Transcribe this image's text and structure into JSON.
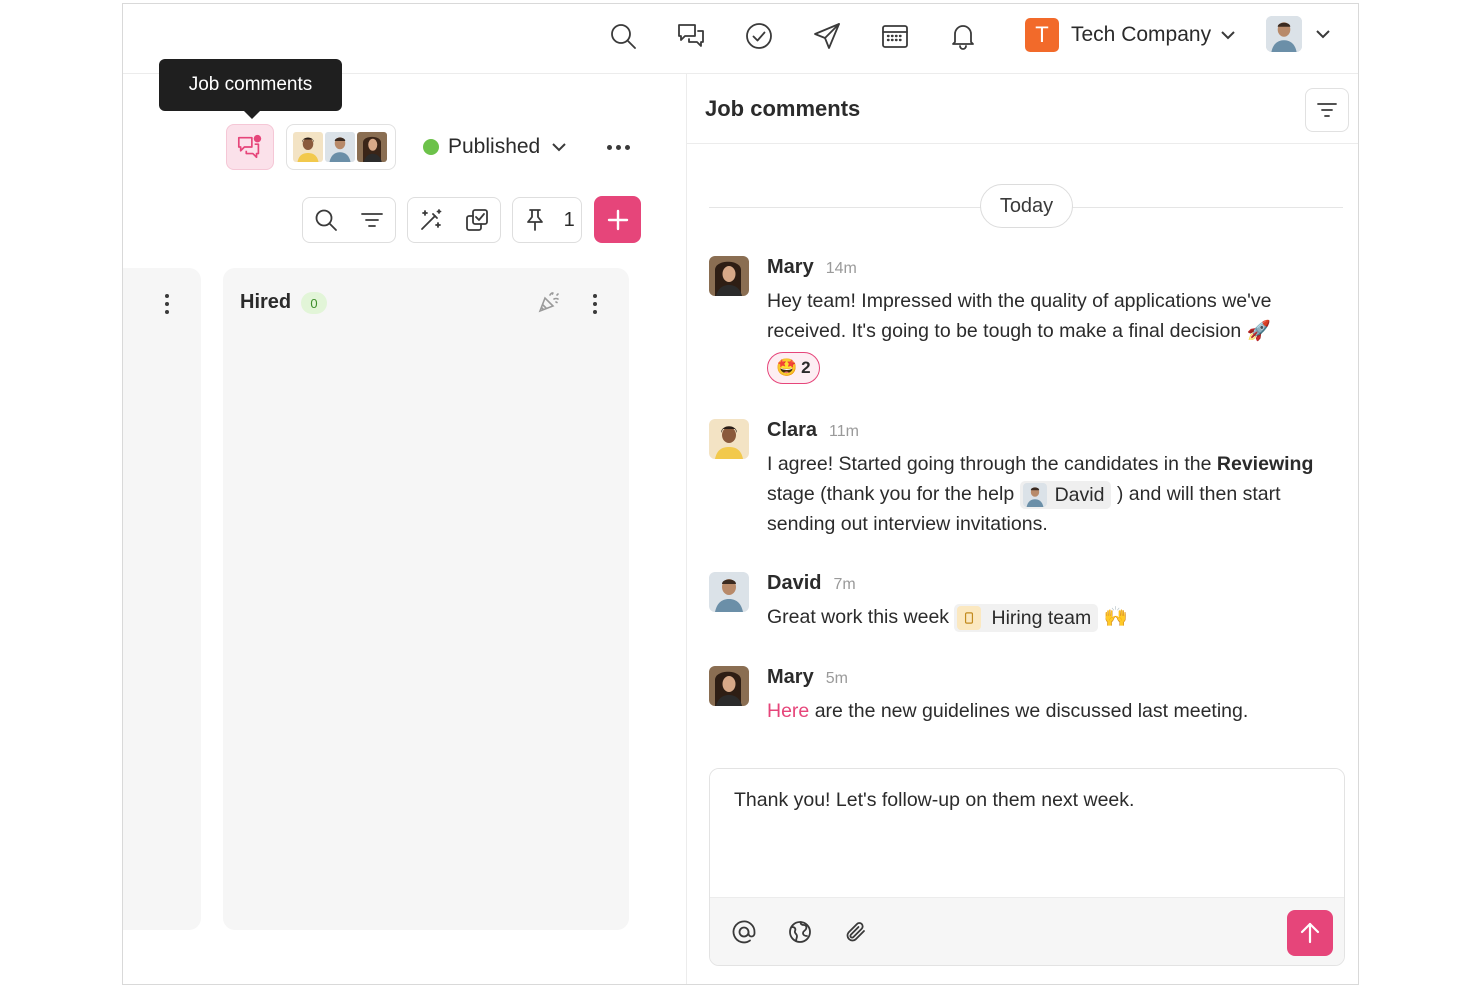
{
  "topbar": {
    "icons": [
      "search-icon",
      "chat-icon",
      "check-circle-icon",
      "send-icon",
      "calendar-icon",
      "bell-icon"
    ],
    "company_initial": "T",
    "company_name": "Tech Company",
    "accent": "#e6457a",
    "company_color": "#f26a2a"
  },
  "tooltip": {
    "text": "Job comments"
  },
  "job_header": {
    "status_label": "Published",
    "status_color": "#6cc24a"
  },
  "toolbar": {
    "pin_count": "1"
  },
  "pipeline": {
    "column_title": "Hired",
    "column_count": "0"
  },
  "comments_panel": {
    "title": "Job comments",
    "day_label": "Today",
    "comments": [
      {
        "name": "Mary",
        "time": "14m",
        "text": "Hey team! Impressed with the quality of applications we've received. It's going to be tough to make a final decision 🚀",
        "reaction_emoji": "🤩",
        "reaction_count": "2"
      },
      {
        "name": "Clara",
        "time": "11m",
        "text_before": "I agree! Started going through the candidates in the ",
        "text_bold": "Reviewing",
        "text_middle": " stage (thank you for the help ",
        "mention": "David",
        "text_after": " ) and will then start sending out interview invitations."
      },
      {
        "name": "David",
        "time": "7m",
        "text_before": "Great work this week ",
        "group_mention": "Hiring team",
        "text_after": " 🙌"
      },
      {
        "name": "Mary",
        "time": "5m",
        "link_text": "Here",
        "text_after": " are the new guidelines we discussed last meeting."
      }
    ]
  },
  "composer": {
    "value": "Thank you! Let's follow-up on them next week.",
    "icons": [
      "at-icon",
      "globe-icon",
      "paperclip-icon"
    ]
  }
}
